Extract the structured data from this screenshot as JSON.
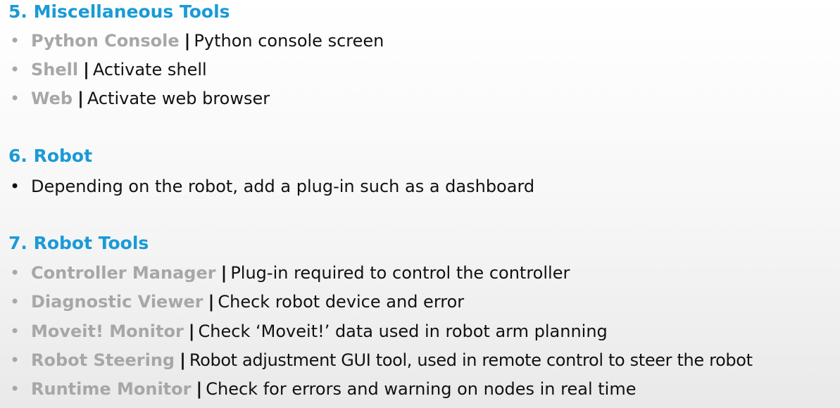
{
  "sections": {
    "misc": {
      "heading": "5. Miscellaneous Tools",
      "items": [
        {
          "term": "Python Console",
          "sep": "|",
          "desc": "Python console screen"
        },
        {
          "term": "Shell",
          "sep": "|",
          "desc": "Activate shell"
        },
        {
          "term": "Web",
          "sep": "|",
          "desc": "Activate web browser"
        }
      ]
    },
    "robot": {
      "heading": "6. Robot",
      "items": [
        {
          "desc": "Depending on the robot, add a plug-in such as a dashboard"
        }
      ]
    },
    "robot_tools": {
      "heading": "7. Robot Tools",
      "items": [
        {
          "term": "Controller Manager",
          "sep": "|",
          "desc": "Plug-in required to control the controller"
        },
        {
          "term": "Diagnostic Viewer",
          "sep": "|",
          "desc": "Check robot device and error"
        },
        {
          "term": "Moveit! Monitor",
          "sep": "|",
          "desc": "Check ‘Moveit!’ data used in robot arm planning"
        },
        {
          "term": "Robot Steering",
          "sep": "|",
          "desc": "Robot adjustment GUI tool, used in remote control to steer the robot"
        },
        {
          "term": "Runtime Monitor",
          "sep": "|",
          "desc": "Check for errors and warning on nodes in real time"
        }
      ]
    }
  },
  "bullet_char": "•",
  "colors": {
    "heading": "#1a9ad6",
    "term": "#a7a7a7",
    "text": "#111111"
  }
}
